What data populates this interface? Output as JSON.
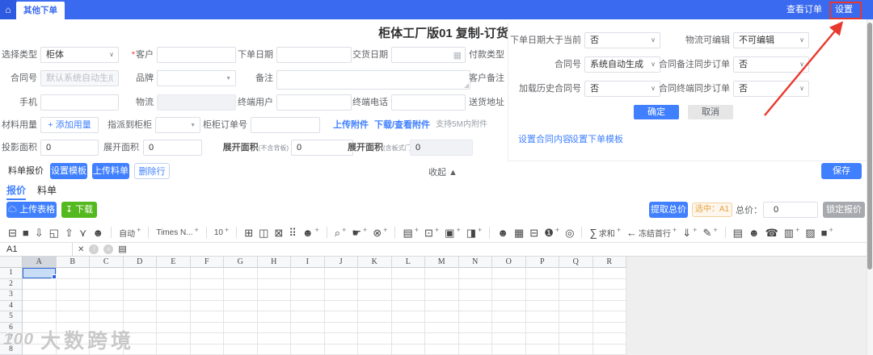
{
  "colors": {
    "topbar": "#3a6af0",
    "accent": "#4080ff",
    "green": "#53b91e",
    "red": "#e8392e",
    "warning": "#e6a23c"
  },
  "topbar": {
    "tab": "其他下单",
    "view_orders": "查看订单",
    "settings": "设置",
    "home_icon": "⌂"
  },
  "title": "柜体工厂版01 复制-订货单",
  "form": {
    "type_label": "选择类型",
    "type_value": "柜体",
    "required_mark": "*",
    "customer_label": "客户",
    "order_date_label": "下单日期",
    "delivery_date_label": "交货日期",
    "payment_label": "付款类型",
    "contract_label": "合同号",
    "contract_placeholder": "默认系统自动生成",
    "brand_label": "品牌",
    "note_label": "备注",
    "customer_note_label": "客户备注",
    "phone_label": "手机",
    "logistics_label": "物流",
    "terminal_user_label": "终端用户",
    "terminal_phone_label": "终端电话",
    "address_label": "送货地址",
    "material_label": "材料用量",
    "add_usage_label": "+ 添加用量",
    "assign_label": "指派到柜柜",
    "cabinet_order_label": "柜柜订单号",
    "upload_attach": "上传附件",
    "download_attach": "下载/查看附件",
    "attach_hint": "支持5M内附件",
    "area1_label": "投影面积",
    "area1_value": "0",
    "area2_label": "展开面积",
    "area2_value": "0",
    "area3_label": "展开面积",
    "area3_sub": "(不含背板)",
    "area3_value": "0",
    "area4_label": "展开面积",
    "area4_sub": "(含板式门)",
    "area4_value": "0"
  },
  "settings_panel": {
    "rows": [
      {
        "label": "下单日期大于当前",
        "value": "否"
      },
      {
        "label": "物流可编辑",
        "value": "不可编辑"
      },
      {
        "label": "合同号",
        "value": "系统自动生成"
      },
      {
        "label": "合同备注同步订单",
        "value": "否"
      },
      {
        "label": "加载历史合同号",
        "value": "否"
      },
      {
        "label": "合同终端同步订单",
        "value": "否"
      }
    ],
    "confirm": "确定",
    "cancel": "取消",
    "link_contract": "设置合同内容",
    "link_template": "设置下单模板"
  },
  "quote": {
    "section_label": "料单报价",
    "btn_template": "设置模板",
    "btn_upload": "上传料单",
    "btn_delete": "删除行",
    "collapse_label": "收起 ▲",
    "save": "保存",
    "tab_quote": "报价",
    "tab_list": "料单",
    "upload_table": "上传表格",
    "upload_icon": "☁",
    "download": "下载",
    "download_icon": "↧",
    "extract_total": "提取总价",
    "selected_badge": "选中：A1",
    "total_label": "总价：",
    "total_value": "0",
    "lock_quote": "锁定报价"
  },
  "toolbar": {
    "icons": [
      {
        "g": "⊟",
        "n": "save-icon"
      },
      {
        "g": "■",
        "n": "truck-icon"
      },
      {
        "g": "⇩",
        "n": "import-icon"
      },
      {
        "g": "◱",
        "n": "layout-icon"
      },
      {
        "g": "⇧",
        "n": "export-icon"
      },
      {
        "g": "⋎",
        "n": "filter-icon"
      },
      {
        "g": "☻",
        "n": "users-icon"
      },
      {
        "sep": true
      },
      {
        "t": "自动",
        "plus": true,
        "n": "auto-format-select"
      },
      {
        "sep": true
      },
      {
        "t": "Times N...",
        "plus": true,
        "n": "font-family-select"
      },
      {
        "sep": true
      },
      {
        "t": "10",
        "plus": true,
        "n": "font-size-select"
      },
      {
        "sep": true
      },
      {
        "g": "⊞",
        "n": "border-icon"
      },
      {
        "g": "◫",
        "n": "merge-cells-icon"
      },
      {
        "g": "⊠",
        "n": "lock-icon"
      },
      {
        "g": "⠿",
        "n": "grid-icon"
      },
      {
        "g": "☻",
        "plus": true,
        "n": "user-add-icon"
      },
      {
        "sep": true
      },
      {
        "g": "⌕",
        "plus": true,
        "n": "search-icon"
      },
      {
        "g": "☛",
        "plus": true,
        "n": "pointer-icon"
      },
      {
        "g": "⊗",
        "plus": true,
        "n": "remove-icon"
      },
      {
        "sep": true
      },
      {
        "g": "▤",
        "plus": true,
        "n": "document-icon"
      },
      {
        "g": "⊡",
        "plus": true,
        "n": "safe-icon"
      },
      {
        "g": "▣",
        "plus": true,
        "n": "card-icon"
      },
      {
        "g": "◨",
        "plus": true,
        "n": "image-icon"
      },
      {
        "sep": true
      },
      {
        "g": "☻",
        "n": "contact-icon"
      },
      {
        "g": "▦",
        "n": "brush-icon"
      },
      {
        "g": "⊟",
        "n": "archive-icon"
      },
      {
        "g": "❶",
        "plus": true,
        "n": "info-icon"
      },
      {
        "g": "◎",
        "n": "location-icon"
      },
      {
        "sep": true
      },
      {
        "g": "∑",
        "t": "求和",
        "plus": true,
        "n": "sum-icon"
      },
      {
        "g": "←",
        "t": "冻结首行",
        "plus": true,
        "n": "freeze-row-icon"
      },
      {
        "g": "⇓",
        "plus": true,
        "n": "download-icon"
      },
      {
        "g": "✎",
        "plus": true,
        "n": "edit-icon"
      },
      {
        "sep": true
      },
      {
        "g": "▤",
        "n": "list-icon"
      },
      {
        "g": "☻",
        "n": "user-icon"
      },
      {
        "g": "☎",
        "n": "phone-icon"
      },
      {
        "g": "▥",
        "plus": true,
        "n": "id-card-icon"
      },
      {
        "g": "▨",
        "n": "chart-icon"
      },
      {
        "g": "■",
        "plus": true,
        "n": "truck2-icon"
      }
    ]
  },
  "formula_bar": {
    "name_box": "A1",
    "icons": [
      {
        "g": "✕",
        "n": "close-icon",
        "c": "fi-x"
      },
      {
        "g": "!",
        "n": "info-circle-icon",
        "c": "fi-circle"
      },
      {
        "g": "⌕",
        "n": "search-circle-icon",
        "c": "fi-circle"
      },
      {
        "g": "▤",
        "n": "clipboard-icon",
        "c": "fi-dark"
      }
    ]
  },
  "sheet": {
    "columns": [
      "A",
      "B",
      "C",
      "D",
      "E",
      "F",
      "G",
      "H",
      "I",
      "J",
      "K",
      "L",
      "M",
      "N",
      "O",
      "P",
      "Q",
      "R"
    ],
    "rows": [
      "1",
      "2",
      "3",
      "4",
      "5",
      "6",
      "7",
      "8"
    ],
    "selected_cell": "A1"
  },
  "watermark": {
    "logo": "100",
    "text": "大数跨境"
  }
}
